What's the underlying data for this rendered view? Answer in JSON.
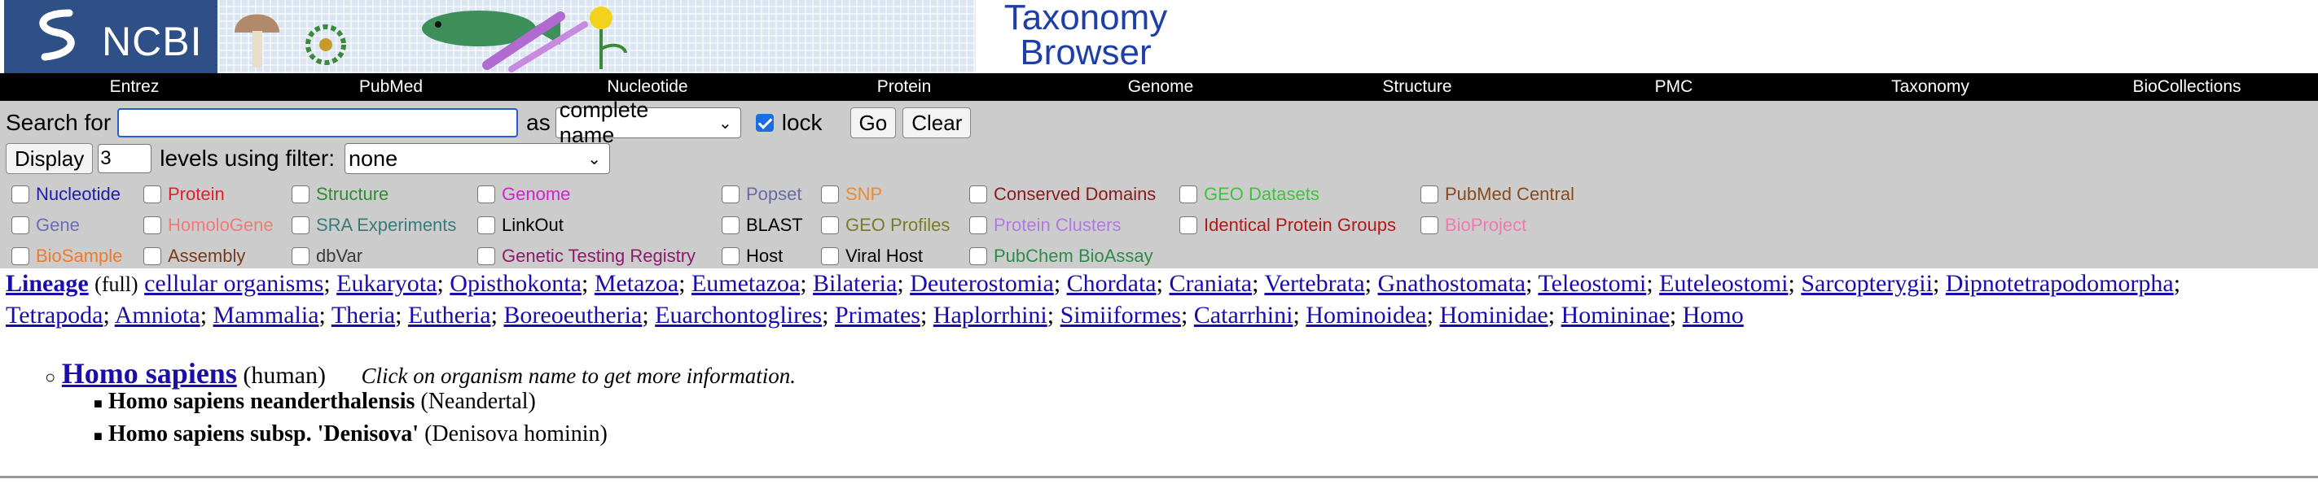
{
  "brand": {
    "logo_text": "NCBI",
    "title_line1": "Taxonomy",
    "title_line2": "Browser"
  },
  "nav": [
    "Entrez",
    "PubMed",
    "Nucleotide",
    "Protein",
    "Genome",
    "Structure",
    "PMC",
    "Taxonomy",
    "BioCollections"
  ],
  "search": {
    "label": "Search for",
    "value": "",
    "as_label": "as",
    "as_value": "complete name",
    "lock_label": "lock",
    "lock_checked": true,
    "go_label": "Go",
    "clear_label": "Clear"
  },
  "display": {
    "button_label": "Display",
    "levels_value": "3",
    "levels_text": "levels using filter:",
    "filter_value": "none"
  },
  "databases": [
    {
      "label": "Nucleotide",
      "color": "#1c1cb0"
    },
    {
      "label": "Protein",
      "color": "#e0202a"
    },
    {
      "label": "Structure",
      "color": "#2e8b2e"
    },
    {
      "label": "Genome",
      "color": "#d61fd1"
    },
    {
      "label": "Popset",
      "color": "#6a6aa8"
    },
    {
      "label": "SNP",
      "color": "#f08a2a"
    },
    {
      "label": "Conserved Domains",
      "color": "#8b1a1a"
    },
    {
      "label": "GEO Datasets",
      "color": "#3cc43c"
    },
    {
      "label": "PubMed Central",
      "color": "#8b4a1a"
    },
    {
      "label": "Gene",
      "color": "#6b6bb8"
    },
    {
      "label": "HomoloGene",
      "color": "#f07a7a"
    },
    {
      "label": "SRA Experiments",
      "color": "#3a7a7a"
    },
    {
      "label": "LinkOut",
      "color": "#000000"
    },
    {
      "label": "BLAST",
      "color": "#000000"
    },
    {
      "label": "GEO Profiles",
      "color": "#7a7a2a"
    },
    {
      "label": "Protein Clusters",
      "color": "#b07ae0"
    },
    {
      "label": "Identical Protein Groups",
      "color": "#b01a1a"
    },
    {
      "label": "BioProject",
      "color": "#f07ab0"
    },
    {
      "label": "BioSample",
      "color": "#f07a2a"
    },
    {
      "label": "Assembly",
      "color": "#7a3a1a"
    },
    {
      "label": "dbVar",
      "color": "#3a3a3a"
    },
    {
      "label": "Genetic Testing Registry",
      "color": "#8b1a6b"
    },
    {
      "label": "Host",
      "color": "#000000"
    },
    {
      "label": "Viral Host",
      "color": "#000000"
    },
    {
      "label": "PubChem BioAssay",
      "color": "#2e8b4a"
    }
  ],
  "lineage": {
    "label": "Lineage",
    "mode": "(full)",
    "items": [
      "cellular organisms",
      "Eukaryota",
      "Opisthokonta",
      "Metazoa",
      "Eumetazoa",
      "Bilateria",
      "Deuterostomia",
      "Chordata",
      "Craniata",
      "Vertebrata",
      "Gnathostomata",
      "Teleostomi",
      "Euteleostomi",
      "Sarcopterygii",
      "Dipnotetrapodomorpha",
      "Tetrapoda",
      "Amniota",
      "Mammalia",
      "Theria",
      "Eutheria",
      "Boreoeutheria",
      "Euarchontoglires",
      "Primates",
      "Haplorrhini",
      "Simiiformes",
      "Catarrhini",
      "Hominoidea",
      "Hominidae",
      "Homininae",
      "Homo"
    ]
  },
  "organism": {
    "name": "Homo sapiens",
    "common": "(human)",
    "hint": "Click on organism name to get more information.",
    "subspecies": [
      {
        "name": "Homo sapiens neanderthalensis",
        "common": "(Neandertal)"
      },
      {
        "name": "Homo sapiens subsp. 'Denisova'",
        "common": "(Denisova hominin)"
      }
    ]
  }
}
